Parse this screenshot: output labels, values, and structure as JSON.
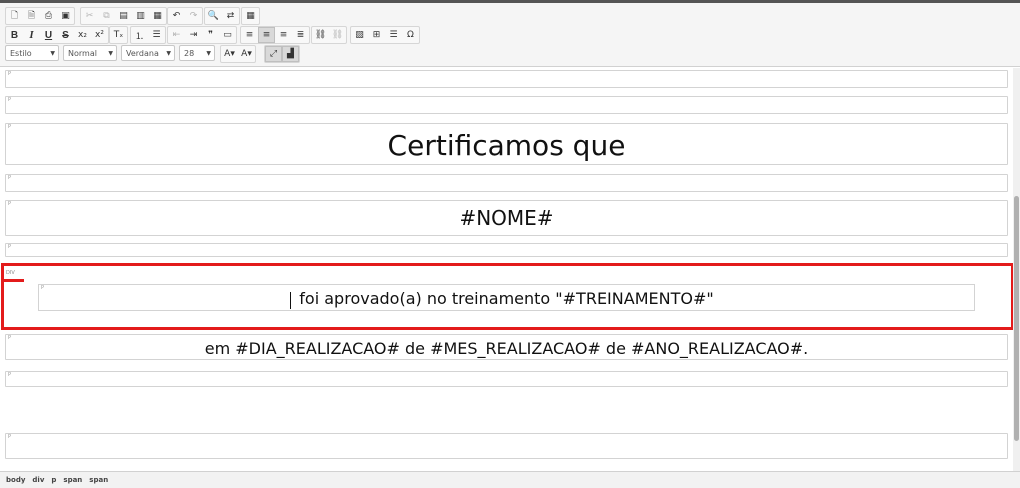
{
  "toolbar": {
    "row1_group1": [
      {
        "name": "new-page-icon",
        "glyph": "🗋"
      },
      {
        "name": "templates-icon",
        "glyph": "🗎"
      },
      {
        "name": "print-icon",
        "glyph": "⎙"
      },
      {
        "name": "save-icon",
        "glyph": "▣"
      }
    ],
    "row1_group2": [
      {
        "name": "cut-icon",
        "glyph": "✂",
        "disabled": true
      },
      {
        "name": "copy-icon",
        "glyph": "⧉",
        "disabled": true
      },
      {
        "name": "paste-icon",
        "glyph": "▤"
      },
      {
        "name": "paste-text-icon",
        "glyph": "▥"
      },
      {
        "name": "paste-word-icon",
        "glyph": "▦"
      }
    ],
    "row1_group3": [
      {
        "name": "undo-icon",
        "glyph": "↶"
      },
      {
        "name": "redo-icon",
        "glyph": "↷",
        "disabled": true
      }
    ],
    "row1_group4": [
      {
        "name": "find-icon",
        "glyph": "🔍"
      },
      {
        "name": "replace-icon",
        "glyph": "⇄"
      }
    ],
    "row1_group5": [
      {
        "name": "select-all-icon",
        "glyph": "▦"
      }
    ],
    "row2_group1": [
      {
        "name": "bold-icon",
        "glyph": "B",
        "style": "bold"
      },
      {
        "name": "italic-icon",
        "glyph": "I",
        "style": "ital"
      },
      {
        "name": "underline-icon",
        "glyph": "U",
        "style": "und"
      },
      {
        "name": "strikethrough-icon",
        "glyph": "S",
        "style": "strk"
      },
      {
        "name": "subscript-icon",
        "glyph": "x₂"
      },
      {
        "name": "superscript-icon",
        "glyph": "x²"
      }
    ],
    "row2_group2": [
      {
        "name": "remove-format-icon",
        "glyph": "Tₓ"
      }
    ],
    "row2_group3": [
      {
        "name": "numbered-list-icon",
        "glyph": "⒈"
      },
      {
        "name": "bulleted-list-icon",
        "glyph": "☰"
      }
    ],
    "row2_group4": [
      {
        "name": "outdent-icon",
        "glyph": "⇤",
        "disabled": true
      },
      {
        "name": "indent-icon",
        "glyph": "⇥"
      },
      {
        "name": "blockquote-icon",
        "glyph": "❞"
      },
      {
        "name": "create-div-icon",
        "glyph": "▭"
      }
    ],
    "row2_group5": [
      {
        "name": "align-left-icon",
        "glyph": "≡"
      },
      {
        "name": "align-center-icon",
        "glyph": "≡",
        "active": true
      },
      {
        "name": "align-right-icon",
        "glyph": "≡"
      },
      {
        "name": "align-justify-icon",
        "glyph": "≣"
      }
    ],
    "row2_group6": [
      {
        "name": "link-icon",
        "glyph": "⛓"
      },
      {
        "name": "unlink-icon",
        "glyph": "⛓",
        "disabled": true
      }
    ],
    "row2_group7": [
      {
        "name": "image-icon",
        "glyph": "▨"
      },
      {
        "name": "table-icon",
        "glyph": "⊞"
      },
      {
        "name": "horizontal-line-icon",
        "glyph": "☰"
      },
      {
        "name": "special-char-icon",
        "glyph": "Ω"
      }
    ],
    "row3_combos": {
      "style": "Estilo",
      "format": "Normal",
      "font": "Verdana",
      "size": "28"
    },
    "row3_group1": [
      {
        "name": "text-color-icon",
        "glyph": "A▾"
      },
      {
        "name": "bg-color-icon",
        "glyph": "A▾"
      }
    ],
    "row3_group2": [
      {
        "name": "maximize-icon",
        "glyph": "⤢",
        "active": true
      },
      {
        "name": "show-blocks-icon",
        "glyph": "▟",
        "active": true
      }
    ]
  },
  "content": {
    "block_tag": "P",
    "div_tag": "DIV",
    "title": "Certificamos que",
    "name": "#NOME#",
    "approved": "foi aprovado(a) no treinamento \"#TREINAMENTO#\"",
    "date_line": "em #DIA_REALIZACAO# de #MES_REALIZACAO# de #ANO_REALIZACAO#."
  },
  "statusbar": {
    "path": [
      "body",
      "div",
      "p",
      "span",
      "span"
    ]
  }
}
